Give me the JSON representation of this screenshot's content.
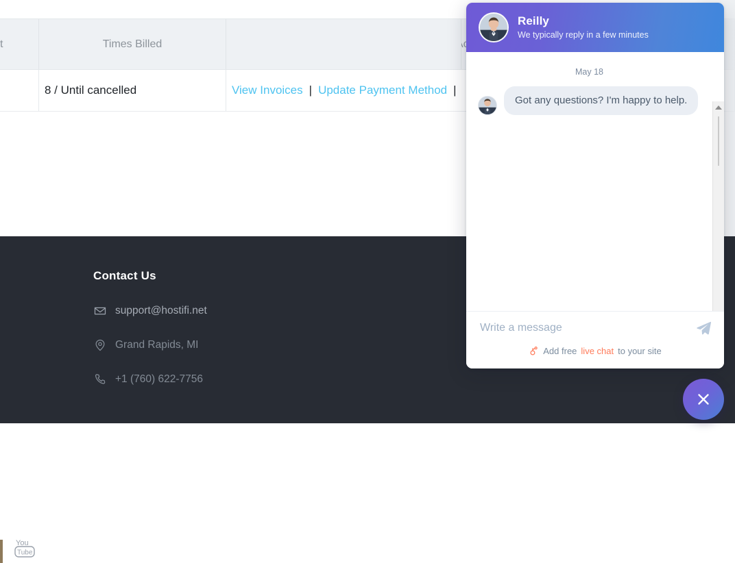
{
  "table": {
    "headers": [
      "t",
      "Times Billed",
      "",
      "Ac"
    ],
    "rows": [
      {
        "col0": "",
        "times_billed": "8 / Until cancelled",
        "actions": [
          {
            "label": "View Invoices"
          },
          {
            "label": "Update Payment Method"
          }
        ],
        "separator": "|"
      }
    ]
  },
  "footer": {
    "title": "Contact Us",
    "social": {
      "youtube_label": "YouTube"
    },
    "items": [
      {
        "icon": "envelope-icon",
        "text": "support@hostifi.net"
      },
      {
        "icon": "location-pin-icon",
        "text": "Grand Rapids, MI"
      },
      {
        "icon": "phone-icon",
        "text": "+1 (760) 622-7756"
      }
    ]
  },
  "chat": {
    "header": {
      "name": "Reilly",
      "subtitle": "We typically reply in a few minutes",
      "gradient_start": "#6f5ad6",
      "gradient_end": "#3f87dd"
    },
    "date_separator": "May 18",
    "messages": [
      {
        "from": "agent",
        "text": "Got any questions? I'm happy to help."
      }
    ],
    "input": {
      "placeholder": "Write a message",
      "value": "",
      "send_label": "Send"
    },
    "branding": {
      "prefix": "Add free",
      "link": "live chat",
      "suffix": "to your site",
      "accent": "#ff7a59"
    }
  },
  "fab": {
    "label": "Close chat",
    "icon": "close-icon"
  }
}
